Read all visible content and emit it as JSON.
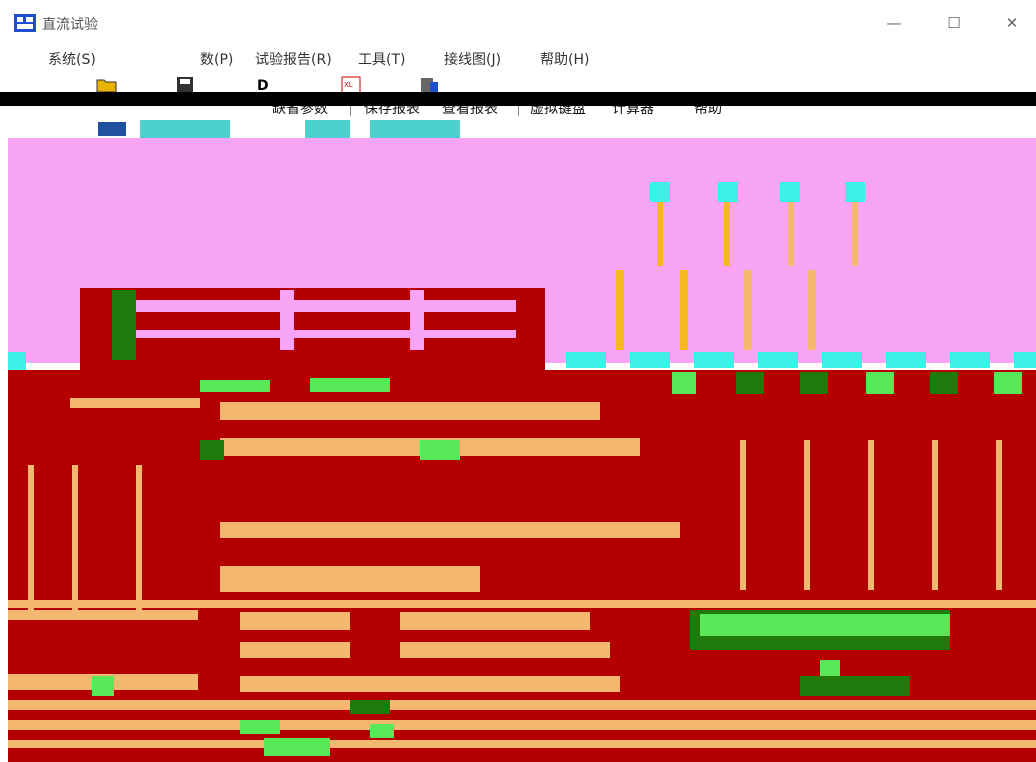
{
  "window": {
    "title": "直流试验",
    "controls": {
      "minimize": "—",
      "maximize": "☐",
      "close": "✕"
    }
  },
  "menu": {
    "items": [
      {
        "label": "系统(S)"
      },
      {
        "label": "数(P)"
      },
      {
        "label": "试验报告(R)"
      },
      {
        "label": "工具(T)"
      },
      {
        "label": "接线图(J)"
      },
      {
        "label": "帮助(H)"
      }
    ]
  },
  "toolbar": {
    "items": [
      {
        "label": "缺省参数",
        "icon": "default-params-icon"
      },
      {
        "label": "保存报表",
        "icon": "save-icon"
      },
      {
        "label": "查看报表",
        "icon": "report-icon"
      },
      {
        "label": "虚拟键盘",
        "icon": "keyboard-icon"
      },
      {
        "label": "计算器",
        "icon": "calculator-icon"
      },
      {
        "label": "帮助",
        "icon": "help-icon"
      }
    ]
  },
  "colors": {
    "pink": "#f7a4f5",
    "red": "#b40000",
    "orange": "#f5b870",
    "cyan": "#3ff0e8",
    "green": "#1e7a0a",
    "lime": "#58e858",
    "yellow": "#f5b820",
    "titlebar_icon": "#1f4fd0"
  }
}
